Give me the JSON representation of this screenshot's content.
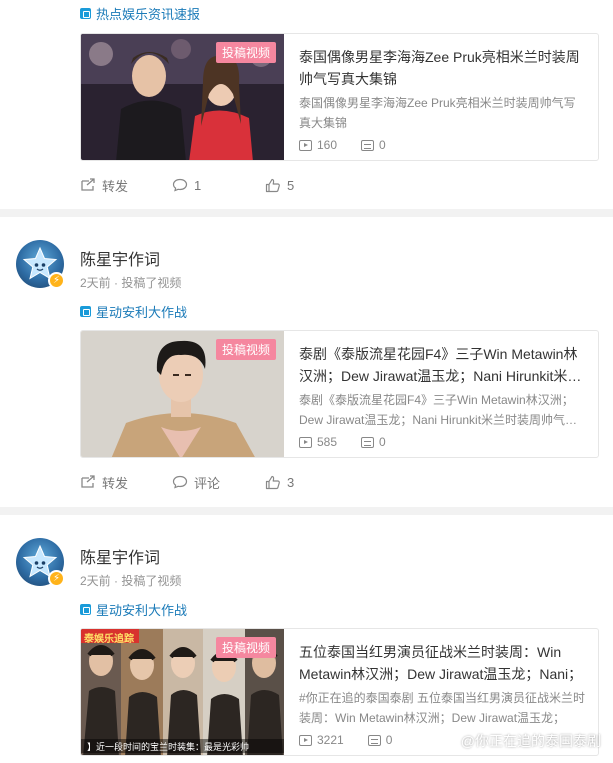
{
  "colors": {
    "accent": "#1a7ab8",
    "tag_bg": "#f5879f",
    "muted": "#939393",
    "separator": "#f2f2f2"
  },
  "posts": [
    {
      "topic": "热点娱乐资讯速报",
      "card": {
        "tag": "投稿视频",
        "title": "泰国偶像男星李海海Zee Pruk亮相米兰时装周帅气写真大集锦",
        "desc": "泰国偶像男星李海海Zee Pruk亮相米兰时装周帅气写真大集锦",
        "plays": "160",
        "comments": "0"
      },
      "actions": {
        "repost": "转发",
        "comment": "1",
        "like": "5"
      }
    },
    {
      "author": {
        "name": "陈星宇作词",
        "meta": "2天前 · 投稿了视频",
        "avatar": "star-avatar",
        "badge": "⚡"
      },
      "topic": "星动安利大作战",
      "card": {
        "tag": "投稿视频",
        "title": "泰剧《泰版流星花园F4》三子Win Metawin林汉洲；Dew Jirawat温玉龙；Nani Hirunkit米兰时装周帅气写真",
        "desc": "泰剧《泰版流星花园F4》三子Win Metawin林汉洲；Dew Jirawat温玉龙；Nani Hirunkit米兰时装周帅气写真",
        "plays": "585",
        "comments": "0"
      },
      "actions": {
        "repost": "转发",
        "comment": "评论",
        "like": "3"
      }
    },
    {
      "author": {
        "name": "陈星宇作词",
        "meta": "2天前 · 投稿了视频",
        "avatar": "star-avatar",
        "badge": "⚡"
      },
      "topic": "星动安利大作战",
      "card": {
        "tag": "投稿视频",
        "title": "五位泰国当红男演员征战米兰时装周：Win Metawin林汉洲；Dew Jirawat温玉龙；Nani；",
        "desc": "#你正在追的泰国泰剧 五位泰国当红男演员征战米兰时装周：Win Metawin林汉洲；Dew Jirawat温玉龙；",
        "plays": "3221",
        "comments": "0",
        "thumb_caption": "】近一段时间的宝兰时装集：最是光彩帅",
        "thumb_banner": "泰娱乐追踪"
      }
    }
  ],
  "watermark": "@你正在追的泰国泰剧"
}
